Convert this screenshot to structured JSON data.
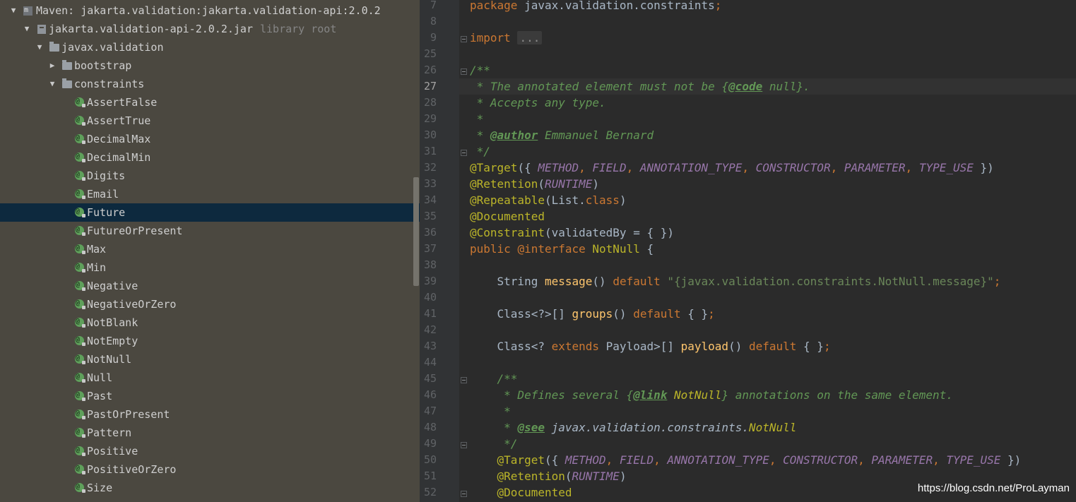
{
  "tree": {
    "maven_label": "Maven: jakarta.validation:jakarta.validation-api:2.0.2",
    "jar_label": "jakarta.validation-api-2.0.2.jar",
    "jar_suffix": "library root",
    "package_label": "javax.validation",
    "bootstrap_label": "bootstrap",
    "constraints_label": "constraints",
    "selected_item": "Future",
    "annotations": [
      "AssertFalse",
      "AssertTrue",
      "DecimalMax",
      "DecimalMin",
      "Digits",
      "Email",
      "Future",
      "FutureOrPresent",
      "Max",
      "Min",
      "Negative",
      "NegativeOrZero",
      "NotBlank",
      "NotEmpty",
      "NotNull",
      "Null",
      "Past",
      "PastOrPresent",
      "Pattern",
      "Positive",
      "PositiveOrZero",
      "Size"
    ]
  },
  "editor": {
    "current_line": "27",
    "lines": [
      {
        "n": "7",
        "parts": [
          {
            "t": "package",
            "c": "kw"
          },
          {
            "t": " javax.validation.constraints"
          },
          {
            "t": ";",
            "c": "kw"
          }
        ]
      },
      {
        "n": "8",
        "parts": []
      },
      {
        "n": "9",
        "fold": true,
        "parts": [
          {
            "t": "import",
            "c": "kw"
          },
          {
            "t": " "
          },
          {
            "t": "...",
            "c": "fold-dots"
          }
        ]
      },
      {
        "n": "25",
        "parts": []
      },
      {
        "n": "26",
        "fold": true,
        "parts": [
          {
            "t": "/**",
            "c": "doc"
          }
        ]
      },
      {
        "n": "27",
        "parts": [
          {
            "t": " * The annotated element must not be {",
            "c": "doc"
          },
          {
            "t": "@code",
            "c": "doctag"
          },
          {
            "t": " null}.",
            "c": "doc"
          }
        ]
      },
      {
        "n": "28",
        "parts": [
          {
            "t": " * Accepts any type.",
            "c": "doc"
          }
        ]
      },
      {
        "n": "29",
        "parts": [
          {
            "t": " *",
            "c": "doc"
          }
        ]
      },
      {
        "n": "30",
        "parts": [
          {
            "t": " * ",
            "c": "doc"
          },
          {
            "t": "@author",
            "c": "doctag"
          },
          {
            "t": " Emmanuel Bernard",
            "c": "doc"
          }
        ]
      },
      {
        "n": "31",
        "fold": true,
        "parts": [
          {
            "t": " */",
            "c": "doc"
          }
        ]
      },
      {
        "n": "32",
        "parts": [
          {
            "t": "@Target",
            "c": "ann"
          },
          {
            "t": "({ "
          },
          {
            "t": "METHOD",
            "c": "cnst"
          },
          {
            "t": ", ",
            "c": "kw"
          },
          {
            "t": "FIELD",
            "c": "cnst"
          },
          {
            "t": ", ",
            "c": "kw"
          },
          {
            "t": "ANNOTATION_TYPE",
            "c": "cnst"
          },
          {
            "t": ", ",
            "c": "kw"
          },
          {
            "t": "CONSTRUCTOR",
            "c": "cnst"
          },
          {
            "t": ", ",
            "c": "kw"
          },
          {
            "t": "PARAMETER",
            "c": "cnst"
          },
          {
            "t": ", ",
            "c": "kw"
          },
          {
            "t": "TYPE_USE",
            "c": "cnst"
          },
          {
            "t": " })"
          }
        ]
      },
      {
        "n": "33",
        "parts": [
          {
            "t": "@Retention",
            "c": "ann"
          },
          {
            "t": "("
          },
          {
            "t": "RUNTIME",
            "c": "cnst"
          },
          {
            "t": ")"
          }
        ]
      },
      {
        "n": "34",
        "parts": [
          {
            "t": "@Repeatable",
            "c": "ann"
          },
          {
            "t": "(List."
          },
          {
            "t": "class",
            "c": "kw"
          },
          {
            "t": ")"
          }
        ]
      },
      {
        "n": "35",
        "parts": [
          {
            "t": "@Documented",
            "c": "ann"
          }
        ]
      },
      {
        "n": "36",
        "parts": [
          {
            "t": "@Constraint",
            "c": "ann"
          },
          {
            "t": "(validatedBy = { })"
          }
        ]
      },
      {
        "n": "37",
        "parts": [
          {
            "t": "public",
            "c": "kw"
          },
          {
            "t": " "
          },
          {
            "t": "@interface",
            "c": "kw"
          },
          {
            "t": " "
          },
          {
            "t": "NotNull",
            "c": "ann"
          },
          {
            "t": " {"
          }
        ]
      },
      {
        "n": "38",
        "parts": []
      },
      {
        "n": "39",
        "parts": [
          {
            "t": "    String "
          },
          {
            "t": "message",
            "c": "meth"
          },
          {
            "t": "() "
          },
          {
            "t": "default",
            "c": "kw"
          },
          {
            "t": " "
          },
          {
            "t": "\"{javax.validation.constraints.NotNull.message}\"",
            "c": "str"
          },
          {
            "t": ";",
            "c": "kw"
          }
        ]
      },
      {
        "n": "40",
        "parts": []
      },
      {
        "n": "41",
        "parts": [
          {
            "t": "    Class<?>[] "
          },
          {
            "t": "groups",
            "c": "meth"
          },
          {
            "t": "() "
          },
          {
            "t": "default",
            "c": "kw"
          },
          {
            "t": " { }"
          },
          {
            "t": ";",
            "c": "kw"
          }
        ]
      },
      {
        "n": "42",
        "parts": []
      },
      {
        "n": "43",
        "parts": [
          {
            "t": "    Class<? "
          },
          {
            "t": "extends",
            "c": "kw"
          },
          {
            "t": " Payload>[] "
          },
          {
            "t": "payload",
            "c": "meth"
          },
          {
            "t": "() "
          },
          {
            "t": "default",
            "c": "kw"
          },
          {
            "t": " { }"
          },
          {
            "t": ";",
            "c": "kw"
          }
        ]
      },
      {
        "n": "44",
        "parts": []
      },
      {
        "n": "45",
        "fold": true,
        "parts": [
          {
            "t": "    /**",
            "c": "doc"
          }
        ]
      },
      {
        "n": "46",
        "parts": [
          {
            "t": "     * Defines several {",
            "c": "doc"
          },
          {
            "t": "@link",
            "c": "doctag"
          },
          {
            "t": " "
          },
          {
            "t": "NotNull",
            "c": "docid"
          },
          {
            "t": "} annotations on the same element.",
            "c": "doc"
          }
        ]
      },
      {
        "n": "47",
        "parts": [
          {
            "t": "     *",
            "c": "doc"
          }
        ]
      },
      {
        "n": "48",
        "parts": [
          {
            "t": "     * ",
            "c": "doc"
          },
          {
            "t": "@see",
            "c": "doctag"
          },
          {
            "t": " "
          },
          {
            "t": "javax.validation.constraints.",
            "c": "docref"
          },
          {
            "t": "NotNull",
            "c": "docid"
          }
        ]
      },
      {
        "n": "49",
        "fold": true,
        "parts": [
          {
            "t": "     */",
            "c": "doc"
          }
        ]
      },
      {
        "n": "50",
        "parts": [
          {
            "t": "    "
          },
          {
            "t": "@Target",
            "c": "ann"
          },
          {
            "t": "({ "
          },
          {
            "t": "METHOD",
            "c": "cnst"
          },
          {
            "t": ", ",
            "c": "kw"
          },
          {
            "t": "FIELD",
            "c": "cnst"
          },
          {
            "t": ", ",
            "c": "kw"
          },
          {
            "t": "ANNOTATION_TYPE",
            "c": "cnst"
          },
          {
            "t": ", ",
            "c": "kw"
          },
          {
            "t": "CONSTRUCTOR",
            "c": "cnst"
          },
          {
            "t": ", ",
            "c": "kw"
          },
          {
            "t": "PARAMETER",
            "c": "cnst"
          },
          {
            "t": ", ",
            "c": "kw"
          },
          {
            "t": "TYPE_USE",
            "c": "cnst"
          },
          {
            "t": " })"
          }
        ]
      },
      {
        "n": "51",
        "parts": [
          {
            "t": "    "
          },
          {
            "t": "@Retention",
            "c": "ann"
          },
          {
            "t": "("
          },
          {
            "t": "RUNTIME",
            "c": "cnst"
          },
          {
            "t": ")"
          }
        ]
      },
      {
        "n": "52",
        "fold": true,
        "parts": [
          {
            "t": "    "
          },
          {
            "t": "@Documented",
            "c": "ann"
          }
        ]
      }
    ]
  },
  "watermark": "https://blog.csdn.net/ProLayman"
}
